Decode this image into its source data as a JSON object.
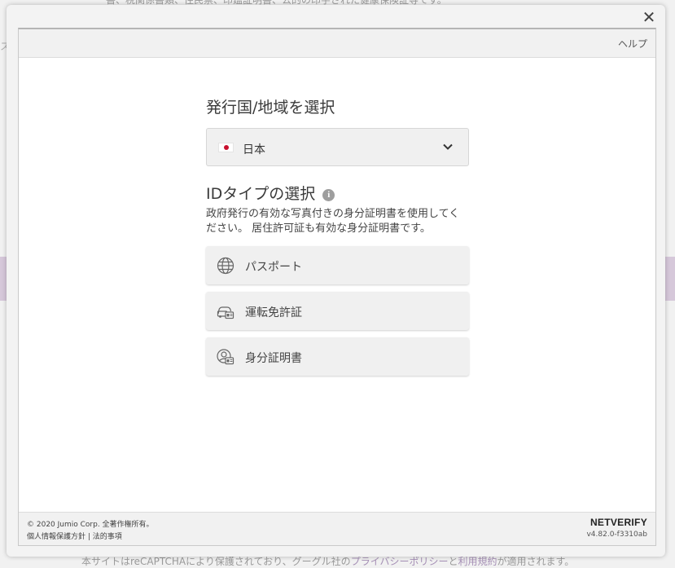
{
  "background": {
    "top_text": "書、税関係書類、住民票、印鑑証明書、公的の印字された健康保険証等です。",
    "left_letter": "ス",
    "bottom_text_before": "本サイトはreCAPTCHAにより保護されており、グーグル社の",
    "bottom_link_privacy": "プライバシーポリシー",
    "bottom_text_and": "と",
    "bottom_link_terms": "利用規約",
    "bottom_text_after": "が適用されます。",
    "link_color": "#a690b6"
  },
  "modal": {
    "close_icon": "close-icon",
    "help_label": "ヘルプ"
  },
  "country": {
    "title": "発行国/地域を選択",
    "selected": "日本",
    "flag_icon": "japan-flag-icon",
    "chevron_icon": "chevron-down-icon"
  },
  "id_type": {
    "title": "IDタイプの選択",
    "info_icon": "info-icon",
    "description": "政府発行の有効な写真付きの身分証明書を使用してください。 居住許可証も有効な身分証明書です。",
    "options": [
      {
        "label": "パスポート",
        "icon": "globe-icon"
      },
      {
        "label": "運転免許証",
        "icon": "car-id-icon"
      },
      {
        "label": "身分証明書",
        "icon": "person-id-icon"
      }
    ]
  },
  "footer": {
    "copyright": "© 2020 Jumio Corp. 全著作権所有。",
    "privacy_link": "個人情報保護方針",
    "separator": " | ",
    "legal_link": "法的事項",
    "brand": "NETVERIFY",
    "version": "v4.82.0-f3310ab"
  },
  "colors": {
    "flag_red": "#c8102e",
    "button_bg": "#f0f0f0"
  }
}
